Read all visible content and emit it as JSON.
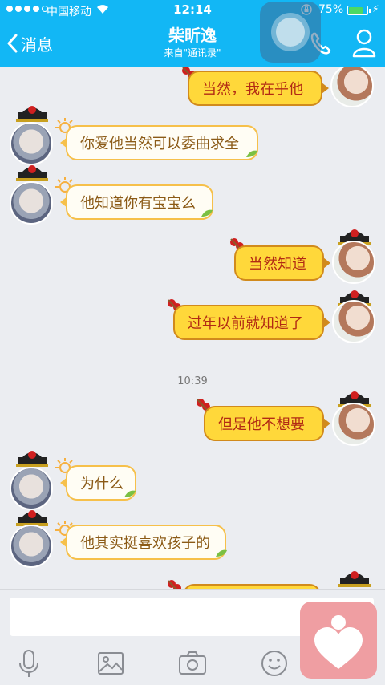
{
  "status_bar": {
    "carrier": "中国移动",
    "time": "12:14",
    "battery": "75%",
    "battery_level": 0.75,
    "signal_filled": 4,
    "signal_total": 5
  },
  "nav": {
    "back_label": "消息",
    "title": "柴昕逸",
    "subtitle": "来自\"通讯录\""
  },
  "messages": [
    {
      "side": "right",
      "text": "当然，我在乎他"
    },
    {
      "side": "left",
      "text": "你爱他当然可以委曲求全"
    },
    {
      "side": "left",
      "text": "他知道你有宝宝么"
    },
    {
      "side": "right",
      "text": "当然知道"
    },
    {
      "side": "right",
      "text": "过年以前就知道了"
    },
    {
      "side": "right",
      "text": "但是他不想要"
    },
    {
      "side": "left",
      "text": "为什么"
    },
    {
      "side": "left",
      "text": "他其实挺喜欢孩子的"
    },
    {
      "side": "right",
      "text": ""
    }
  ],
  "timestamp": "10:39",
  "colors": {
    "nav_blue": "#12b7f5",
    "left_bubble_border": "#f6c04a",
    "left_bubble_text": "#8b5a16",
    "right_bubble_fill": "#ffd83a",
    "right_bubble_text": "#b22a14"
  },
  "toolbar": {
    "icons": [
      "microphone-icon",
      "image-icon",
      "camera-icon",
      "emoji-icon",
      "heart-app-icon"
    ]
  }
}
